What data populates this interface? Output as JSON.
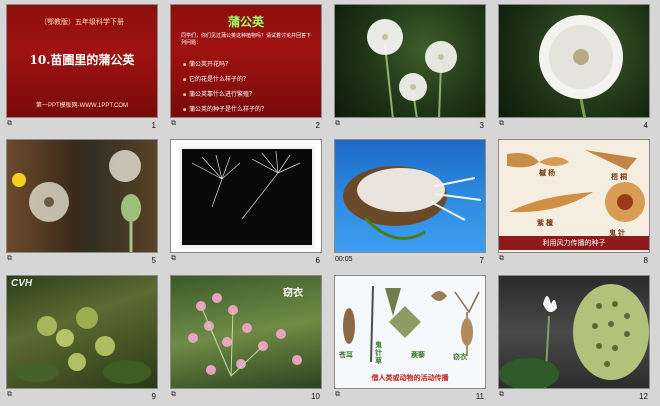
{
  "slides": [
    {
      "number": "1",
      "sub": "（鄂教版）五年级科学下册",
      "title": "10.苗圃里的蒲公英",
      "footer": "第一PPT模板网-WWW.1PPT.COM"
    },
    {
      "number": "2",
      "title": "蒲公英",
      "intro": "同学们，你们见过蒲公英这种植物吗？请试着讨论并回答下列问题：",
      "questions": [
        "蒲公英开花吗？",
        "它的花是什么样子的？",
        "蒲公英靠什么进行繁殖？",
        "蒲公英的种子是什么样子的？"
      ]
    },
    {
      "number": "3"
    },
    {
      "number": "4"
    },
    {
      "number": "5"
    },
    {
      "number": "6"
    },
    {
      "number": "7",
      "time": "00:05"
    },
    {
      "number": "8",
      "labels": [
        "槭 杨",
        "梧 桐",
        "紫 檀",
        "鬼 针"
      ],
      "caption": "利用风力传播的种子"
    },
    {
      "number": "9",
      "watermark": "CVH"
    },
    {
      "number": "10",
      "label": "窃衣"
    },
    {
      "number": "11",
      "labels": [
        "苍耳",
        "鬼针草",
        "蒺藜",
        "窃衣"
      ],
      "caption": "借人类或动物的活动传播"
    },
    {
      "number": "12"
    }
  ]
}
